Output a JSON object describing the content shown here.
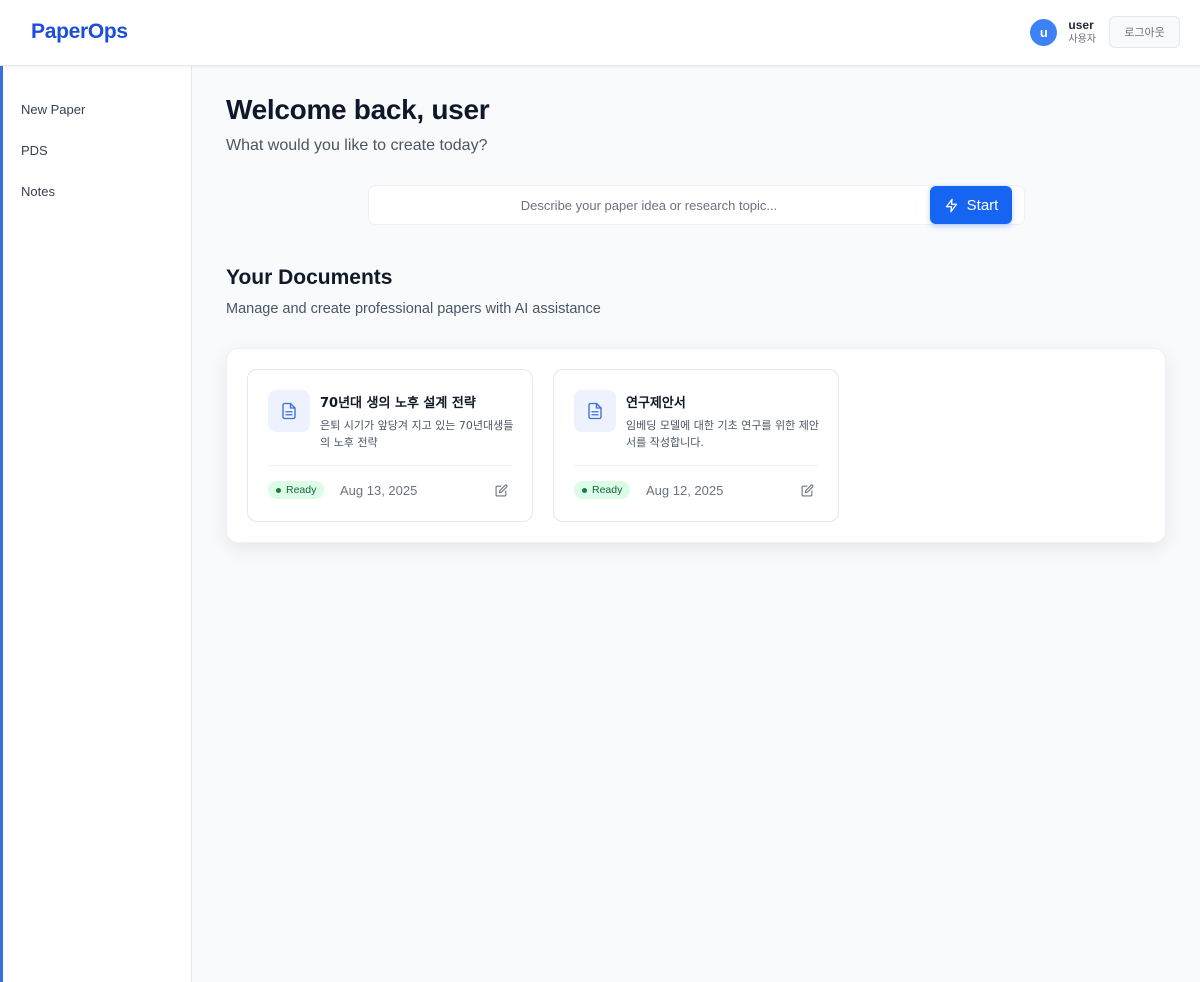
{
  "app": {
    "logo": "PaperOps"
  },
  "header": {
    "avatar_letter": "u",
    "user_name": "user",
    "user_role": "사용자",
    "logout_label": "로그아웃"
  },
  "sidebar": {
    "items": [
      {
        "label": "New Paper"
      },
      {
        "label": "PDS"
      },
      {
        "label": "Notes"
      }
    ]
  },
  "main": {
    "welcome": "Welcome back, user",
    "subtitle": "What would you like to create today?",
    "search": {
      "placeholder": "Describe your paper idea or research topic...",
      "value": "",
      "button_label": "Start",
      "button_icon": "lightning-icon"
    },
    "documents": {
      "title": "Your Documents",
      "subtitle": "Manage and create professional papers with AI assistance",
      "items": [
        {
          "title": "70년대 생의 노후 설계 전략",
          "description": "은퇴 시기가 앞당겨 지고 있는 70년대생들의 노후 전략",
          "status": "Ready",
          "date": "Aug 13, 2025",
          "icon": "document-icon"
        },
        {
          "title": "연구제안서",
          "description": "임베딩 모델에 대한 기초 연구를 위한 제안서를 작성합니다.",
          "status": "Ready",
          "date": "Aug 12, 2025",
          "icon": "document-icon"
        }
      ]
    }
  },
  "colors": {
    "brand": "#1d4ed8",
    "primary_button": "#1664f2",
    "sidebar_accent": "#3b6fe0",
    "status_ready_bg": "#dcfce7",
    "status_ready_text": "#166534"
  }
}
